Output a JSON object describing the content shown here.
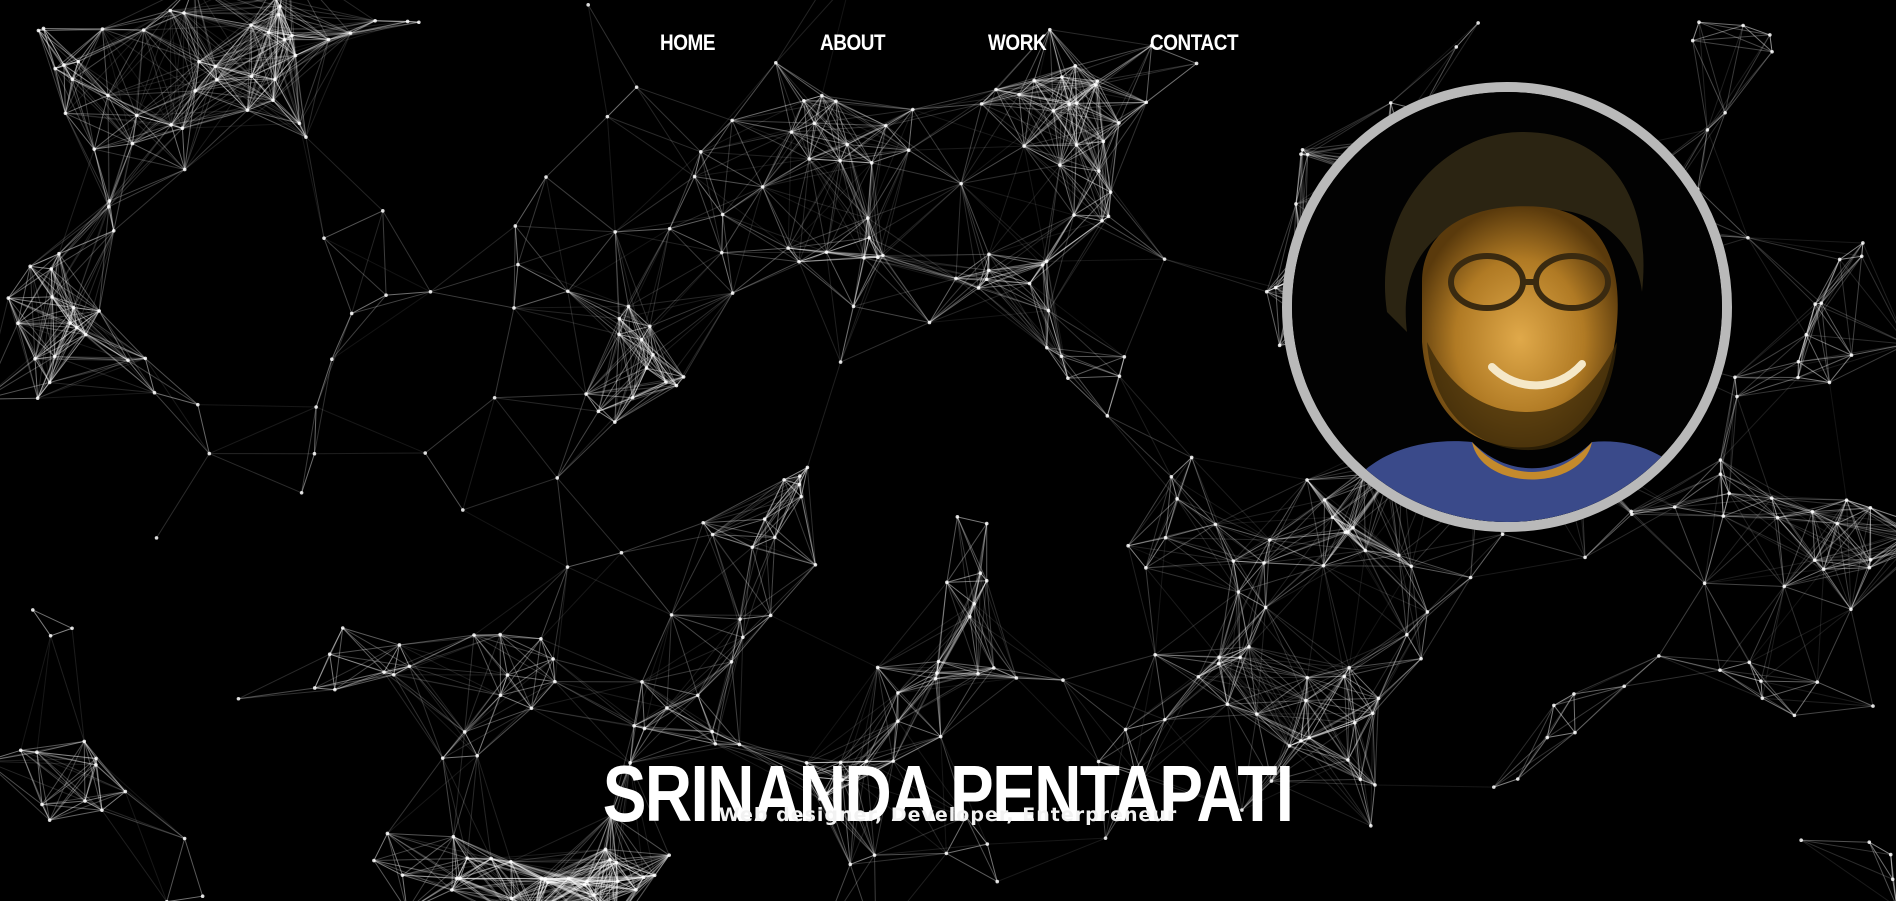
{
  "nav": {
    "items": [
      {
        "label": "HOME"
      },
      {
        "label": "ABOUT"
      },
      {
        "label": "WORK"
      },
      {
        "label": "CONTACT"
      }
    ]
  },
  "hero": {
    "name": "SRINANDA PENTAPATI",
    "tagline": "Web designer, Developer, Enterpreneur"
  },
  "colors": {
    "background": "#000000",
    "text": "#ffffff",
    "network_lines": "#ffffff",
    "portrait_ring": "#b9b9b9"
  },
  "icons": {
    "portrait": "avatar-photo"
  }
}
